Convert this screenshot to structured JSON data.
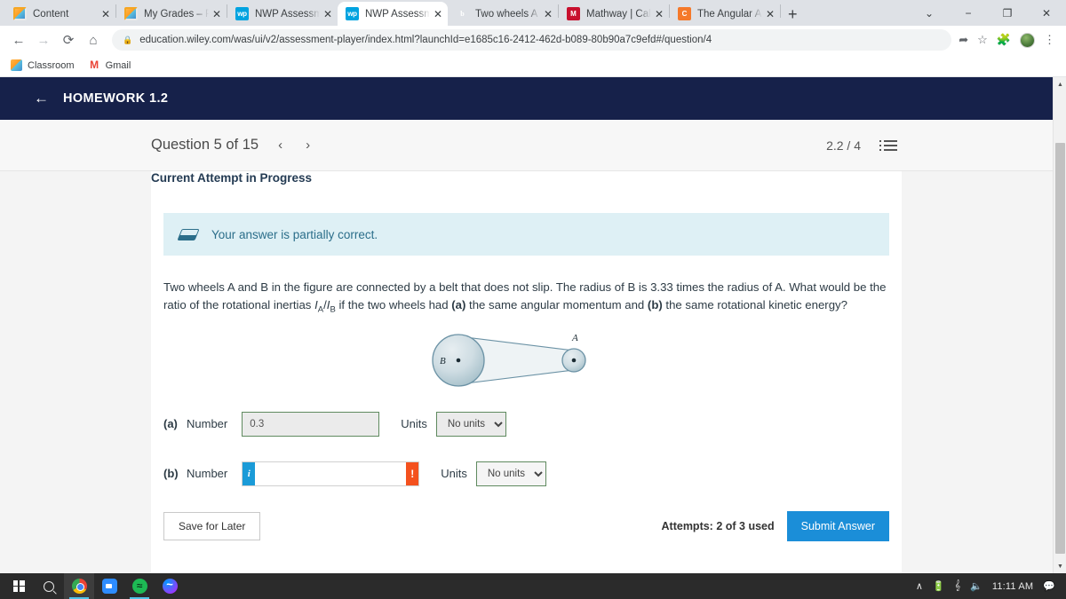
{
  "browser": {
    "tabs": [
      {
        "title": "Content",
        "favicon": "classroom-icon",
        "active": false
      },
      {
        "title": "My Grades – PHY",
        "favicon": "classroom-icon",
        "active": false
      },
      {
        "title": "NWP Assessment",
        "favicon": "wiley-wp-icon",
        "active": false
      },
      {
        "title": "NWP Assessment",
        "favicon": "wiley-wp-icon",
        "active": true
      },
      {
        "title": "Two wheels A and",
        "favicon": "brainly-b-icon",
        "active": false
      },
      {
        "title": "Mathway | Calcul",
        "favicon": "mathway-m-icon",
        "active": false
      },
      {
        "title": "The Angular Acce",
        "favicon": "chegg-c-icon",
        "active": false
      }
    ],
    "close_glyph": "✕",
    "new_tab_glyph": "+",
    "window_controls": [
      "⌄",
      "−",
      "❐",
      "✕"
    ],
    "nav": {
      "back": "←",
      "forward": "→",
      "reload": "⟳",
      "home": "⌂"
    },
    "url": "education.wiley.com/was/ui/v2/assessment-player/index.html?launchId=e1685c16-2412-462d-b089-80b90a7c9efd#/question/4",
    "lock_glyph": "🔒",
    "toolbar_icons": [
      "share-icon",
      "bookmark-star-icon",
      "extensions-puzzle-icon",
      "profile-avatar",
      "chrome-menu-icon"
    ],
    "bookmarks": [
      {
        "label": "Classroom",
        "icon": "classroom-icon"
      },
      {
        "label": "Gmail",
        "icon": "gmail-icon",
        "glyph": "M"
      }
    ]
  },
  "app": {
    "back_arrow": "←",
    "title": "HOMEWORK 1.2",
    "question_label": "Question 5 of 15",
    "prev_glyph": "‹",
    "next_glyph": "›",
    "score": "2.2 / 4",
    "list_icon": "question-list-icon"
  },
  "content": {
    "attempt_header": "Current Attempt in Progress",
    "alert": {
      "icon": "partially-correct-icon",
      "text": "Your answer is partially correct."
    },
    "question": {
      "part1": "Two wheels A and B in the figure are connected by a belt that does not slip. The radius of B is 3.33 times the radius of A. What would be the ratio of the rotational inertias ",
      "ratio_i": "I",
      "ratio_a": "A",
      "ratio_slash": "/",
      "ratio_i2": "I",
      "ratio_b": "B",
      "part2": " if the two wheels had ",
      "bold_a": "(a)",
      "part3": " the same angular momentum and ",
      "bold_b": "(b)",
      "part4": " the same rotational kinetic energy?"
    },
    "figure": {
      "label_a": "A",
      "label_b": "B",
      "description": "two-wheels-belt-diagram"
    },
    "answers": [
      {
        "part": "(a)",
        "number_label": "Number",
        "value": "0.3",
        "placeholder": "",
        "units_label": "Units",
        "unit_value": "No units",
        "unit_options": [
          "No units"
        ],
        "state": "correct",
        "prefix_icon": "",
        "suffix_icon": ""
      },
      {
        "part": "(b)",
        "number_label": "Number",
        "value": "",
        "placeholder": "",
        "units_label": "Units",
        "unit_value": "No units",
        "unit_options": [
          "No units"
        ],
        "state": "incorrect",
        "prefix_icon": "i",
        "suffix_icon": "!"
      }
    ],
    "footer": {
      "save_label": "Save for Later",
      "attempts": "Attempts: 2 of 3 used",
      "submit_label": "Submit Answer"
    }
  },
  "taskbar": {
    "items": [
      "windows-start-icon",
      "search-icon",
      "chrome-icon",
      "zoom-icon",
      "spotify-icon",
      "messenger-icon"
    ],
    "tray": {
      "chevron": "∧",
      "battery": "battery-icon",
      "wifi": "wifi-icon",
      "volume": "volume-icon",
      "clock": "11:11 AM",
      "notifications": "notification-icon"
    }
  },
  "colors": {
    "appbar": "#16214a",
    "accent_blue": "#1b8ed8",
    "alert_bg": "#def0f5",
    "alert_fg": "#2b6e8a",
    "correct_border": "#5f8a5f",
    "error_orange": "#f4511e",
    "info_blue": "#1b9bd8"
  }
}
